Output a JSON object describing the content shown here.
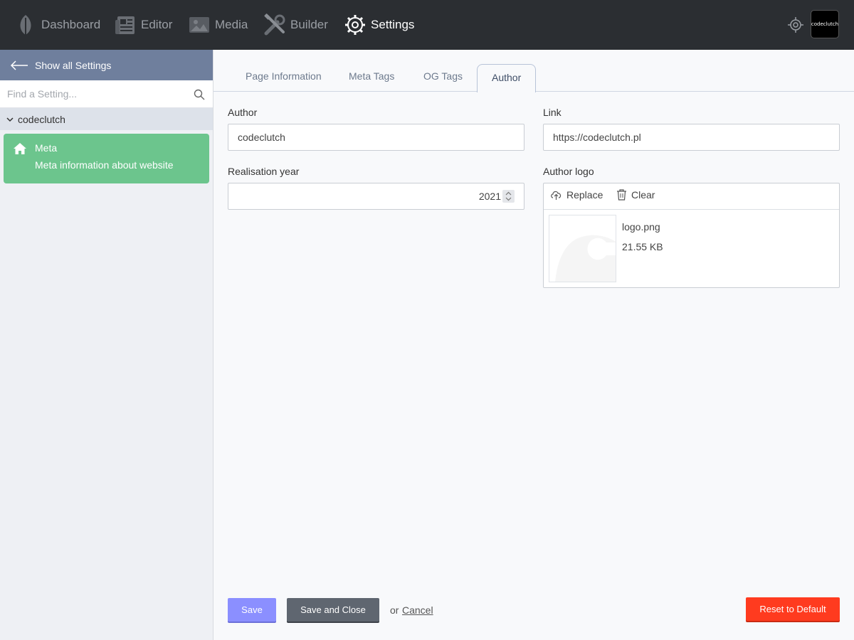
{
  "topnav": {
    "items": [
      {
        "label": "Dashboard",
        "icon": "leaf-icon",
        "active": false
      },
      {
        "label": "Editor",
        "icon": "newspaper-icon",
        "active": false
      },
      {
        "label": "Media",
        "icon": "image-icon",
        "active": false
      },
      {
        "label": "Builder",
        "icon": "tools-icon",
        "active": false
      },
      {
        "label": "Settings",
        "icon": "gear-icon",
        "active": true
      }
    ],
    "target_icon": "crosshair-icon",
    "avatar_text": "codeclutch"
  },
  "sidebar": {
    "show_all_label": "Show all Settings",
    "search_placeholder": "Find a Setting...",
    "group_label": "codeclutch",
    "card": {
      "title": "Meta",
      "description": "Meta information about website",
      "icon": "home-icon"
    }
  },
  "tabs": [
    {
      "label": "Page Information",
      "active": false
    },
    {
      "label": "Meta Tags",
      "active": false
    },
    {
      "label": "OG Tags",
      "active": false
    },
    {
      "label": "Author",
      "active": true
    }
  ],
  "form": {
    "author_label": "Author",
    "author_value": "codeclutch",
    "link_label": "Link",
    "link_value": "https://codeclutch.pl",
    "year_label": "Realisation year",
    "year_value": "2021",
    "logo_label": "Author logo",
    "replace_label": "Replace",
    "clear_label": "Clear",
    "file_name": "logo.png",
    "file_size": "21.55 KB"
  },
  "actions": {
    "save_label": "Save",
    "save_close_label": "Save and Close",
    "or_text": "or",
    "cancel_label": "Cancel",
    "reset_label": "Reset to Default"
  },
  "colors": {
    "topbar": "#2b2e32",
    "sidebar_header": "#6f7f9d",
    "card_green": "#6cc58d",
    "save_button": "#8b8fff",
    "reset_button": "#ff3b1f"
  }
}
